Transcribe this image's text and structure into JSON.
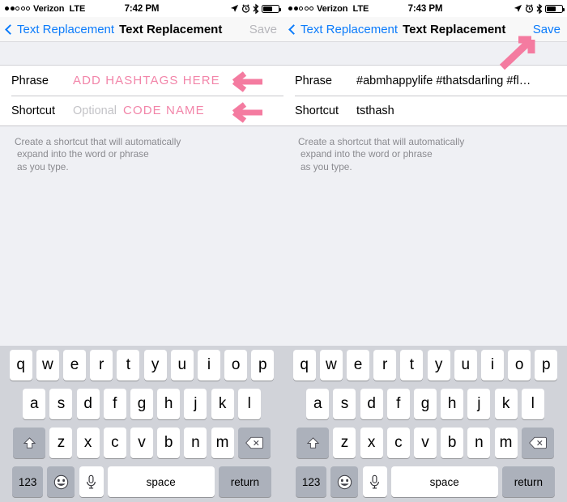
{
  "meta": {
    "accent_blue": "#0b7bfb",
    "annotation_pink": "#f47ba0",
    "ink_pink": "#f291b2",
    "keyboard_bg": "#d1d3d9",
    "panel_bg": "#eff0f4"
  },
  "panels": [
    {
      "id": "left",
      "status_bar": {
        "carrier": "Verizon",
        "network": "LTE",
        "time": "7:42 PM",
        "signal_filled": 2,
        "signal_total": 5,
        "icons": [
          "location-arrow-icon",
          "alarm-clock-icon",
          "bluetooth-icon",
          "battery-icon"
        ]
      },
      "nav": {
        "back_label": "Text Replacement",
        "title": "Text Replacement",
        "save_label": "Save",
        "save_enabled": false
      },
      "form": {
        "phrase": {
          "label": "Phrase",
          "value": "",
          "placeholder": ""
        },
        "shortcut": {
          "label": "Shortcut",
          "value": "",
          "placeholder": "Optional"
        }
      },
      "ink": {
        "phrase_note": "ADD HASHTAGS HERE",
        "shortcut_note": "CODE NAME"
      },
      "helper": [
        "Create a shortcut that will automatically",
        "expand into the word or phrase",
        "as you type."
      ]
    },
    {
      "id": "right",
      "status_bar": {
        "carrier": "Verizon",
        "network": "LTE",
        "time": "7:43 PM",
        "signal_filled": 2,
        "signal_total": 5,
        "icons": [
          "location-arrow-icon",
          "alarm-clock-icon",
          "bluetooth-icon",
          "battery-icon"
        ]
      },
      "nav": {
        "back_label": "Text Replacement",
        "title": "Text Replacement",
        "save_label": "Save",
        "save_enabled": true
      },
      "form": {
        "phrase": {
          "label": "Phrase",
          "value": "#abmhappylife #thatsdarling #flashesof…",
          "placeholder": ""
        },
        "shortcut": {
          "label": "Shortcut",
          "value": "tsthash",
          "placeholder": "Optional"
        }
      },
      "ink": {
        "phrase_note": "",
        "shortcut_note": ""
      },
      "helper": [
        "Create a shortcut that will automatically",
        "expand into the word or phrase",
        "as you type."
      ]
    }
  ],
  "keyboard": {
    "row1": [
      "q",
      "w",
      "e",
      "r",
      "t",
      "y",
      "u",
      "i",
      "o",
      "p"
    ],
    "row2": [
      "a",
      "s",
      "d",
      "f",
      "g",
      "h",
      "j",
      "k",
      "l"
    ],
    "row3": [
      "z",
      "x",
      "c",
      "v",
      "b",
      "n",
      "m"
    ],
    "shift_key": "shift-icon",
    "backspace_key": "backspace-icon",
    "numbers_key": "123",
    "emoji_key": "emoji-icon",
    "mic_key": "microphone-icon",
    "space_key": "space",
    "return_key": "return"
  },
  "annotations": [
    {
      "name": "arrow-to-phrase-field",
      "direction": "left"
    },
    {
      "name": "arrow-to-shortcut-field",
      "direction": "left"
    },
    {
      "name": "arrow-to-save-button",
      "direction": "up-right"
    }
  ]
}
